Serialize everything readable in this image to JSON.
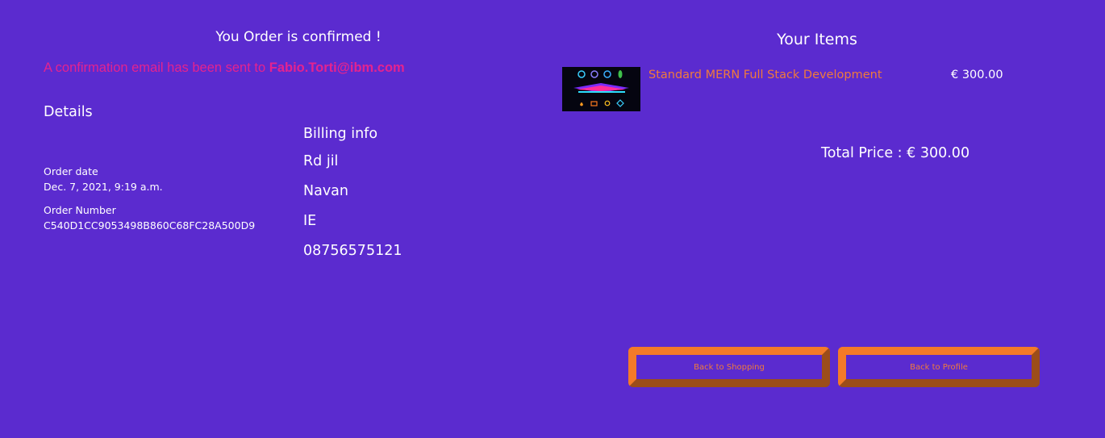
{
  "order": {
    "title": "You Order is confirmed !",
    "message_prefix": "A confirmation email has been sent to ",
    "email": "Fabio.Torti@ibm.com"
  },
  "details": {
    "heading": "Details",
    "order_date_label": "Order date",
    "order_date_value": "Dec. 7, 2021, 9:19 a.m.",
    "order_number_label": "Order Number",
    "order_number_value": "C540D1CC9053498B860C68FC28A500D9"
  },
  "billing": {
    "heading": "Billing info",
    "lines": [
      "Rd jil",
      "Navan",
      "IE",
      "08756575121"
    ]
  },
  "items": {
    "heading": "Your Items",
    "list": [
      {
        "name": "Standard MERN Full Stack Development",
        "price": "€ 300.00"
      }
    ],
    "total": "Total Price : € 300.00"
  },
  "actions": {
    "back_to_shopping": "Back to Shopping",
    "back_to_profile": "Back to Profile"
  },
  "colors": {
    "background": "#5b2bcf",
    "accent_pink": "#e4238f",
    "accent_orange": "#f07a3c",
    "button_border": "#f47a28"
  }
}
